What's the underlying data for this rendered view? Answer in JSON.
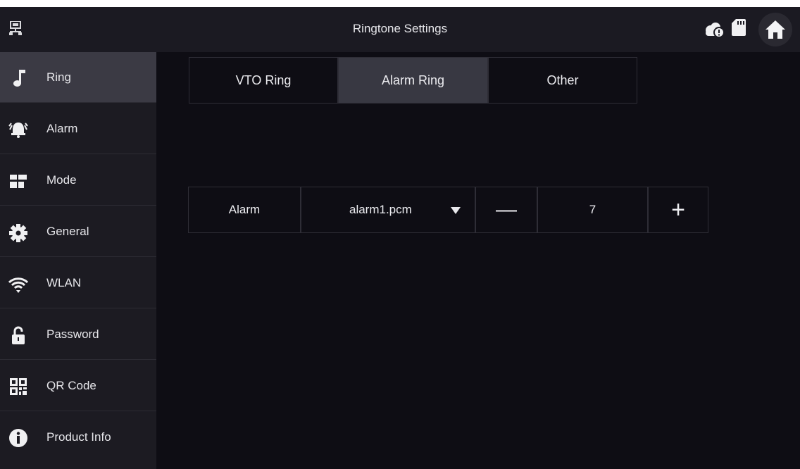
{
  "header": {
    "title": "Ringtone Settings",
    "icons": [
      "network-icon",
      "cloud-icon",
      "sd-card-icon",
      "home-icon"
    ]
  },
  "sidebar": {
    "items": [
      {
        "label": "Ring",
        "icon": "music-note-icon",
        "active": true
      },
      {
        "label": "Alarm",
        "icon": "alarm-bell-icon"
      },
      {
        "label": "Mode",
        "icon": "mode-grid-icon"
      },
      {
        "label": "General",
        "icon": "gear-icon"
      },
      {
        "label": "WLAN",
        "icon": "wifi-icon"
      },
      {
        "label": "Password",
        "icon": "unlock-icon"
      },
      {
        "label": "QR Code",
        "icon": "qr-code-icon"
      },
      {
        "label": "Product Info",
        "icon": "info-icon"
      }
    ]
  },
  "tabs": [
    {
      "label": "VTO Ring",
      "active": false
    },
    {
      "label": "Alarm Ring",
      "active": true
    },
    {
      "label": "Other",
      "active": false
    }
  ],
  "alarm_row": {
    "label": "Alarm",
    "ringtone": "alarm1.pcm",
    "volume": "7",
    "decrement": "—",
    "increment": "+"
  },
  "colors": {
    "background": "#0e0d14",
    "sidebar": "#1c1b22",
    "active": "#3b3a44",
    "text": "#e8e8ec"
  }
}
